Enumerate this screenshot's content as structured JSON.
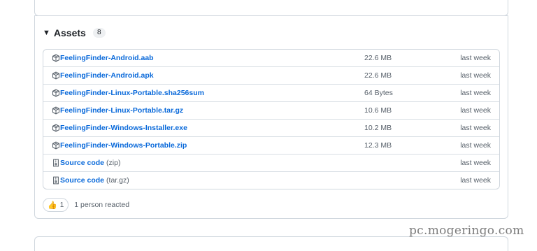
{
  "assets": {
    "title": "Assets",
    "count": "8",
    "items": [
      {
        "name": "FeelingFinder-Android.aab",
        "ext": "",
        "size": "22.6 MB",
        "date": "last week",
        "icon": "package-icon"
      },
      {
        "name": "FeelingFinder-Android.apk",
        "ext": "",
        "size": "22.6 MB",
        "date": "last week",
        "icon": "package-icon"
      },
      {
        "name": "FeelingFinder-Linux-Portable.sha256sum",
        "ext": "",
        "size": "64 Bytes",
        "date": "last week",
        "icon": "package-icon"
      },
      {
        "name": "FeelingFinder-Linux-Portable.tar.gz",
        "ext": "",
        "size": "10.6 MB",
        "date": "last week",
        "icon": "package-icon"
      },
      {
        "name": "FeelingFinder-Windows-Installer.exe",
        "ext": "",
        "size": "10.2 MB",
        "date": "last week",
        "icon": "package-icon"
      },
      {
        "name": "FeelingFinder-Windows-Portable.zip",
        "ext": "",
        "size": "12.3 MB",
        "date": "last week",
        "icon": "package-icon"
      },
      {
        "name": "Source code",
        "ext": "(zip)",
        "size": "",
        "date": "last week",
        "icon": "file-zip-icon"
      },
      {
        "name": "Source code",
        "ext": "(tar.gz)",
        "size": "",
        "date": "last week",
        "icon": "file-zip-icon"
      }
    ]
  },
  "reactions": {
    "count": "1",
    "text": "1 person reacted"
  },
  "watermark": "pc.mogeringo.com",
  "colors": {
    "link": "#0969da",
    "muted": "#57606a",
    "border": "#d0d7de"
  }
}
